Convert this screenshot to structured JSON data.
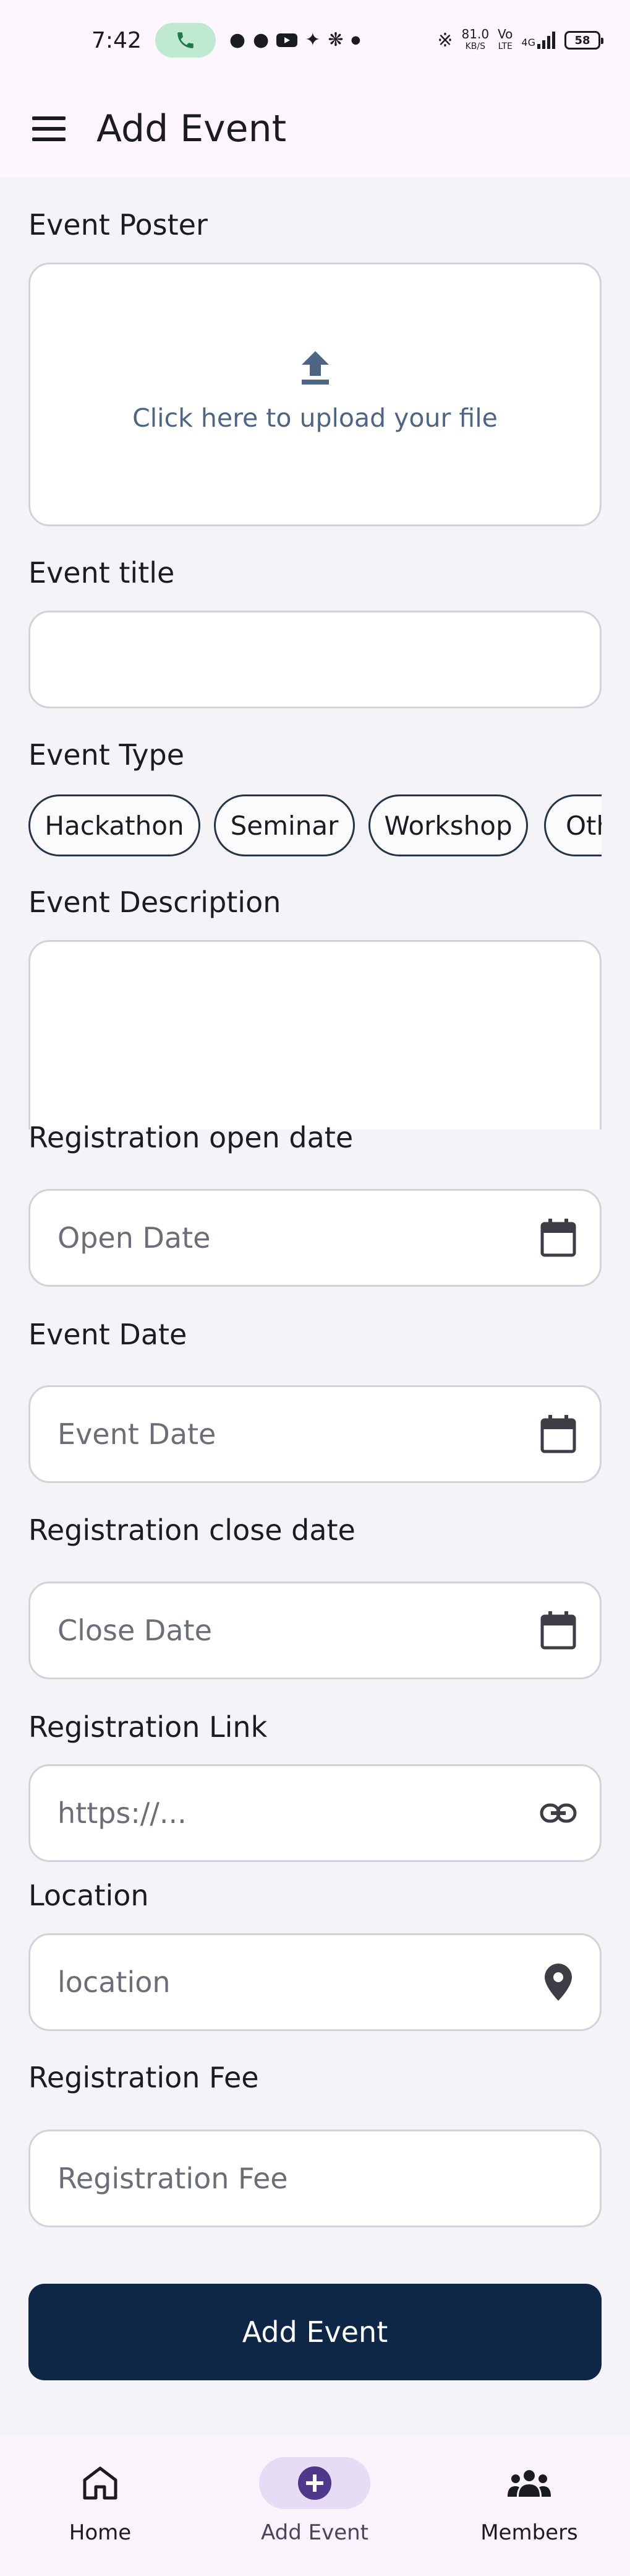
{
  "status_bar": {
    "time": "7:42",
    "net_speed_top": "81.0",
    "net_speed_bottom": "KB/S",
    "volte_top": "Vo",
    "volte_bottom": "LTE",
    "net_type": "4G",
    "battery": "58"
  },
  "app_bar": {
    "title": "Add Event"
  },
  "form": {
    "poster_label": "Event Poster",
    "upload_text": "Click here to upload your file",
    "title_label": "Event title",
    "title_value": "",
    "type_label": "Event Type",
    "event_types": [
      "Hackathon",
      "Seminar",
      "Workshop",
      "Oth"
    ],
    "description_label": "Event Description",
    "open_date_label": "Registration open date",
    "open_date_placeholder": "Open Date",
    "event_date_label": "Event Date",
    "event_date_placeholder": "Event Date",
    "close_date_label": "Registration close date",
    "close_date_placeholder": "Close Date",
    "link_label": "Registration Link",
    "link_placeholder": "https://...",
    "location_label": "Location",
    "location_placeholder": "location",
    "fee_label": "Registration Fee",
    "fee_placeholder": "Registration Fee",
    "submit_label": "Add Event"
  },
  "bottom_nav": {
    "items": [
      {
        "label": "Home",
        "icon": "home-icon"
      },
      {
        "label": "Add Event",
        "icon": "add-circle-icon"
      },
      {
        "label": "Members",
        "icon": "group-icon"
      }
    ],
    "active": "Add Event"
  },
  "colors": {
    "primary_dark": "#0f2747",
    "upload_accent": "#4e6584",
    "nav_active_bg": "#e6dcf5",
    "call_pill": "#bfe9d0"
  }
}
